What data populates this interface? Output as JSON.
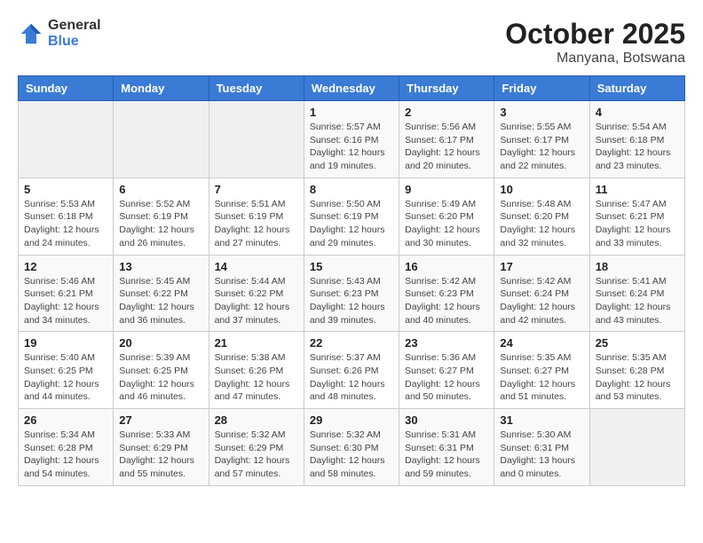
{
  "header": {
    "logo_general": "General",
    "logo_blue": "Blue",
    "month": "October 2025",
    "location": "Manyana, Botswana"
  },
  "weekdays": [
    "Sunday",
    "Monday",
    "Tuesday",
    "Wednesday",
    "Thursday",
    "Friday",
    "Saturday"
  ],
  "weeks": [
    [
      {
        "day": "",
        "info": ""
      },
      {
        "day": "",
        "info": ""
      },
      {
        "day": "",
        "info": ""
      },
      {
        "day": "1",
        "info": "Sunrise: 5:57 AM\nSunset: 6:16 PM\nDaylight: 12 hours\nand 19 minutes."
      },
      {
        "day": "2",
        "info": "Sunrise: 5:56 AM\nSunset: 6:17 PM\nDaylight: 12 hours\nand 20 minutes."
      },
      {
        "day": "3",
        "info": "Sunrise: 5:55 AM\nSunset: 6:17 PM\nDaylight: 12 hours\nand 22 minutes."
      },
      {
        "day": "4",
        "info": "Sunrise: 5:54 AM\nSunset: 6:18 PM\nDaylight: 12 hours\nand 23 minutes."
      }
    ],
    [
      {
        "day": "5",
        "info": "Sunrise: 5:53 AM\nSunset: 6:18 PM\nDaylight: 12 hours\nand 24 minutes."
      },
      {
        "day": "6",
        "info": "Sunrise: 5:52 AM\nSunset: 6:19 PM\nDaylight: 12 hours\nand 26 minutes."
      },
      {
        "day": "7",
        "info": "Sunrise: 5:51 AM\nSunset: 6:19 PM\nDaylight: 12 hours\nand 27 minutes."
      },
      {
        "day": "8",
        "info": "Sunrise: 5:50 AM\nSunset: 6:19 PM\nDaylight: 12 hours\nand 29 minutes."
      },
      {
        "day": "9",
        "info": "Sunrise: 5:49 AM\nSunset: 6:20 PM\nDaylight: 12 hours\nand 30 minutes."
      },
      {
        "day": "10",
        "info": "Sunrise: 5:48 AM\nSunset: 6:20 PM\nDaylight: 12 hours\nand 32 minutes."
      },
      {
        "day": "11",
        "info": "Sunrise: 5:47 AM\nSunset: 6:21 PM\nDaylight: 12 hours\nand 33 minutes."
      }
    ],
    [
      {
        "day": "12",
        "info": "Sunrise: 5:46 AM\nSunset: 6:21 PM\nDaylight: 12 hours\nand 34 minutes."
      },
      {
        "day": "13",
        "info": "Sunrise: 5:45 AM\nSunset: 6:22 PM\nDaylight: 12 hours\nand 36 minutes."
      },
      {
        "day": "14",
        "info": "Sunrise: 5:44 AM\nSunset: 6:22 PM\nDaylight: 12 hours\nand 37 minutes."
      },
      {
        "day": "15",
        "info": "Sunrise: 5:43 AM\nSunset: 6:23 PM\nDaylight: 12 hours\nand 39 minutes."
      },
      {
        "day": "16",
        "info": "Sunrise: 5:42 AM\nSunset: 6:23 PM\nDaylight: 12 hours\nand 40 minutes."
      },
      {
        "day": "17",
        "info": "Sunrise: 5:42 AM\nSunset: 6:24 PM\nDaylight: 12 hours\nand 42 minutes."
      },
      {
        "day": "18",
        "info": "Sunrise: 5:41 AM\nSunset: 6:24 PM\nDaylight: 12 hours\nand 43 minutes."
      }
    ],
    [
      {
        "day": "19",
        "info": "Sunrise: 5:40 AM\nSunset: 6:25 PM\nDaylight: 12 hours\nand 44 minutes."
      },
      {
        "day": "20",
        "info": "Sunrise: 5:39 AM\nSunset: 6:25 PM\nDaylight: 12 hours\nand 46 minutes."
      },
      {
        "day": "21",
        "info": "Sunrise: 5:38 AM\nSunset: 6:26 PM\nDaylight: 12 hours\nand 47 minutes."
      },
      {
        "day": "22",
        "info": "Sunrise: 5:37 AM\nSunset: 6:26 PM\nDaylight: 12 hours\nand 48 minutes."
      },
      {
        "day": "23",
        "info": "Sunrise: 5:36 AM\nSunset: 6:27 PM\nDaylight: 12 hours\nand 50 minutes."
      },
      {
        "day": "24",
        "info": "Sunrise: 5:35 AM\nSunset: 6:27 PM\nDaylight: 12 hours\nand 51 minutes."
      },
      {
        "day": "25",
        "info": "Sunrise: 5:35 AM\nSunset: 6:28 PM\nDaylight: 12 hours\nand 53 minutes."
      }
    ],
    [
      {
        "day": "26",
        "info": "Sunrise: 5:34 AM\nSunset: 6:28 PM\nDaylight: 12 hours\nand 54 minutes."
      },
      {
        "day": "27",
        "info": "Sunrise: 5:33 AM\nSunset: 6:29 PM\nDaylight: 12 hours\nand 55 minutes."
      },
      {
        "day": "28",
        "info": "Sunrise: 5:32 AM\nSunset: 6:29 PM\nDaylight: 12 hours\nand 57 minutes."
      },
      {
        "day": "29",
        "info": "Sunrise: 5:32 AM\nSunset: 6:30 PM\nDaylight: 12 hours\nand 58 minutes."
      },
      {
        "day": "30",
        "info": "Sunrise: 5:31 AM\nSunset: 6:31 PM\nDaylight: 12 hours\nand 59 minutes."
      },
      {
        "day": "31",
        "info": "Sunrise: 5:30 AM\nSunset: 6:31 PM\nDaylight: 13 hours\nand 0 minutes."
      },
      {
        "day": "",
        "info": ""
      }
    ]
  ]
}
